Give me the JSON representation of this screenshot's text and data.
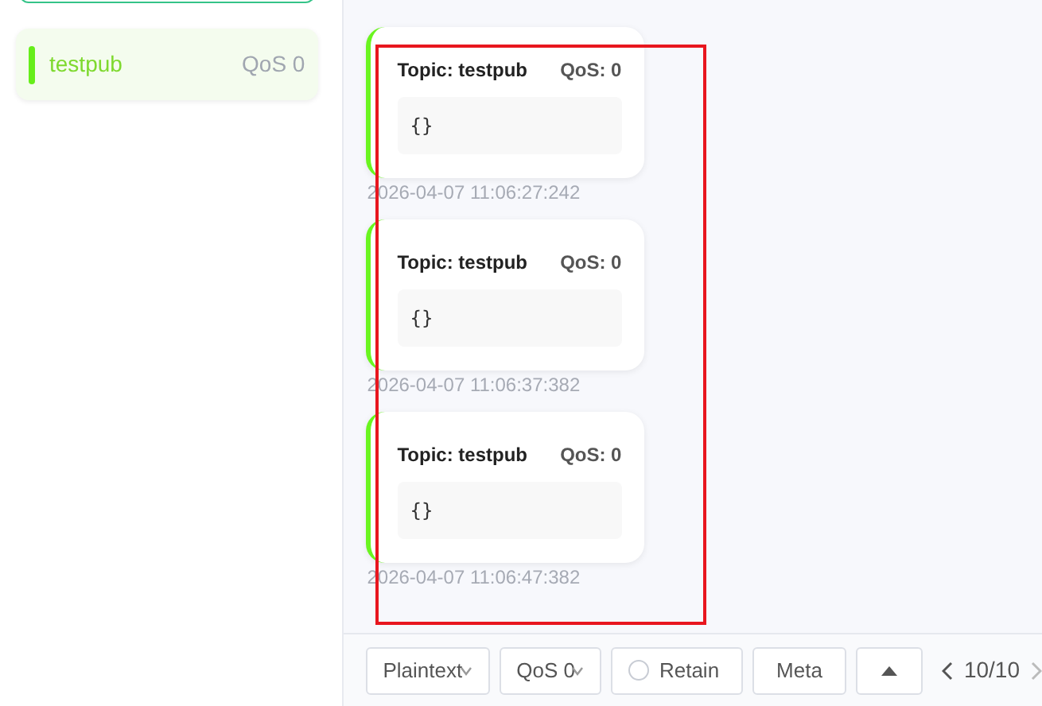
{
  "subscriptions": [
    {
      "topic": "testpub",
      "qos": "QoS 0",
      "color": "#66ee1a",
      "selected": true
    }
  ],
  "messages": [
    {
      "topic": "Topic: testpub",
      "qos": "QoS: 0",
      "payload": "{}",
      "time": "2026-04-07 11:06:27:242"
    },
    {
      "topic": "Topic: testpub",
      "qos": "QoS: 0",
      "payload": "{}",
      "time": "2026-04-07 11:06:37:382"
    },
    {
      "topic": "Topic: testpub",
      "qos": "QoS: 0",
      "payload": "{}",
      "time": "2026-04-07 11:06:47:382"
    }
  ],
  "footer": {
    "format": "Plaintext",
    "qos": "QoS 0",
    "retain": {
      "label": "Retain",
      "checked": false
    },
    "meta": "Meta",
    "page": "10/10"
  }
}
